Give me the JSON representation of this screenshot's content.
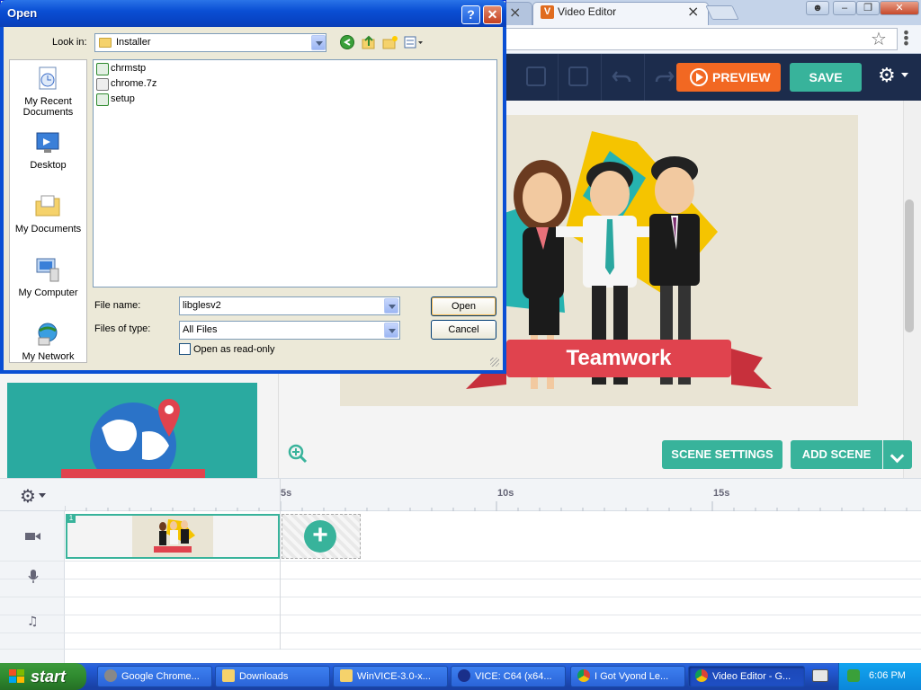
{
  "browser": {
    "active_tab_title": "Video Editor",
    "active_tab_favicon": "V",
    "tab_close": "×"
  },
  "editor": {
    "preview_label": "PREVIEW",
    "save_label": "SAVE",
    "scene_text": "Teamwork",
    "scene_settings_label": "SCENE SETTINGS",
    "add_scene_label": "ADD SCENE",
    "accent_color": "#38b39b",
    "preview_color": "#f26822",
    "toolbar_color": "#1c2c4c"
  },
  "timeline": {
    "ticks": [
      "5s",
      "10s",
      "15s"
    ],
    "scene_number": "1",
    "add_symbol": "+"
  },
  "dialog": {
    "title": "Open",
    "help": "?",
    "close": "✕",
    "look_in_label": "Look in:",
    "look_in_value": "Installer",
    "places": [
      {
        "label": "My Recent Documents",
        "icon": "recent-documents-icon"
      },
      {
        "label": "Desktop",
        "icon": "desktop-icon"
      },
      {
        "label": "My Documents",
        "icon": "my-documents-icon"
      },
      {
        "label": "My Computer",
        "icon": "my-computer-icon"
      },
      {
        "label": "My Network",
        "icon": "my-network-icon"
      }
    ],
    "files": [
      "chrmstp",
      "chrome.7z",
      "setup"
    ],
    "file_name_label": "File name:",
    "file_name_value": "libglesv2",
    "files_of_type_label": "Files of type:",
    "files_of_type_value": "All Files",
    "read_only_label": "Open as read-only",
    "open_button": "Open",
    "cancel_button": "Cancel"
  },
  "taskbar": {
    "start_label": "start",
    "tasks": [
      "Google Chrome...",
      "Downloads",
      "WinVICE-3.0-x...",
      "VICE: C64 (x64...",
      "I Got Vyond Le...",
      "Video Editor - G..."
    ],
    "clock": "6:06 PM"
  }
}
